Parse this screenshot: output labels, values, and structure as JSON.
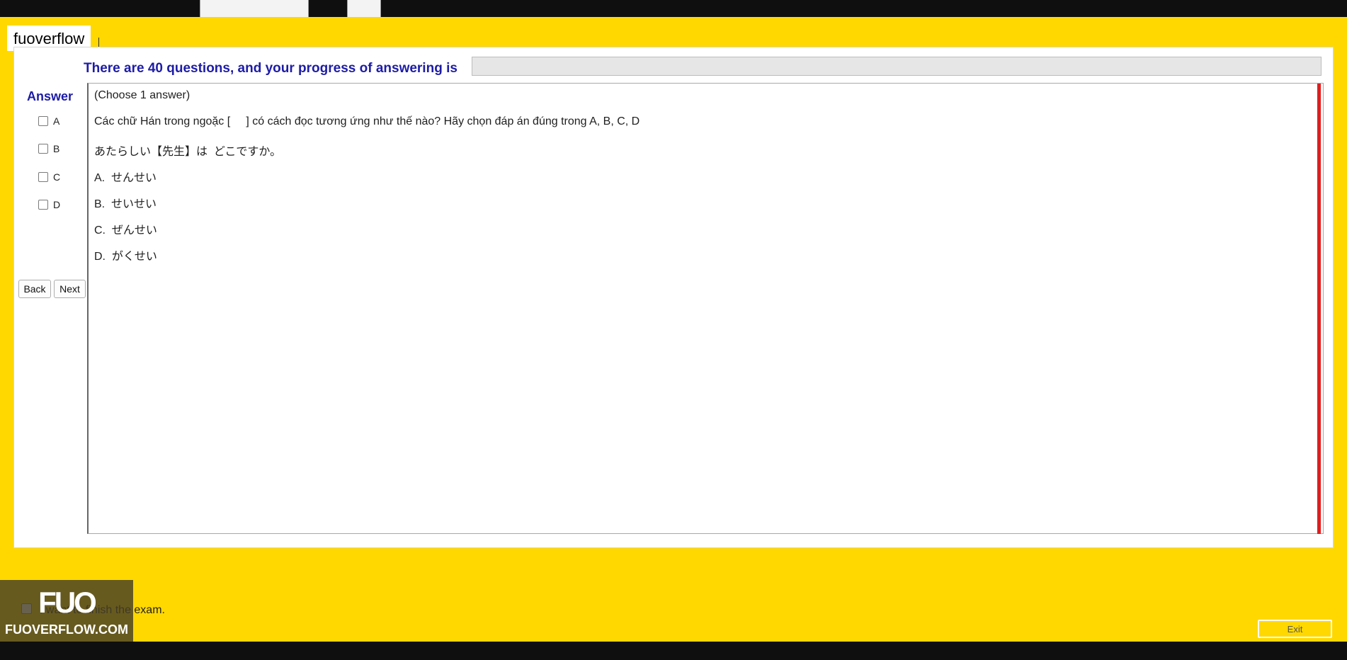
{
  "watermark_tag": "fuoverflow",
  "progress": {
    "text": "There are 40 questions, and your progress of answering is",
    "value_percent": 0
  },
  "answer_panel": {
    "heading": "Answer",
    "options": [
      "A",
      "B",
      "C",
      "D"
    ],
    "back_label": "Back",
    "next_label": "Next"
  },
  "question": {
    "instruction": "(Choose 1 answer)",
    "prompt": "Các chữ Hán trong ngoặc [     ] có cách đọc tương ứng như thế nào? Hãy chọn đáp án đúng trong A, B, C, D",
    "sentence": "あたらしい【先生】は  どこですか。",
    "choices": [
      "A.  せんせい",
      "B.  せいせい",
      "C.  ぜんせい",
      "D.  がくせい"
    ]
  },
  "footer": {
    "finish_label": "I want to finish the exam.",
    "exit_label": "Exit"
  },
  "logo": {
    "mark": "FUO",
    "text": "FUOVERFLOW.COM"
  },
  "colors": {
    "background": "#ffd800",
    "heading_blue": "#1d1ca6",
    "scrollbar_red": "#dd1f1f"
  }
}
